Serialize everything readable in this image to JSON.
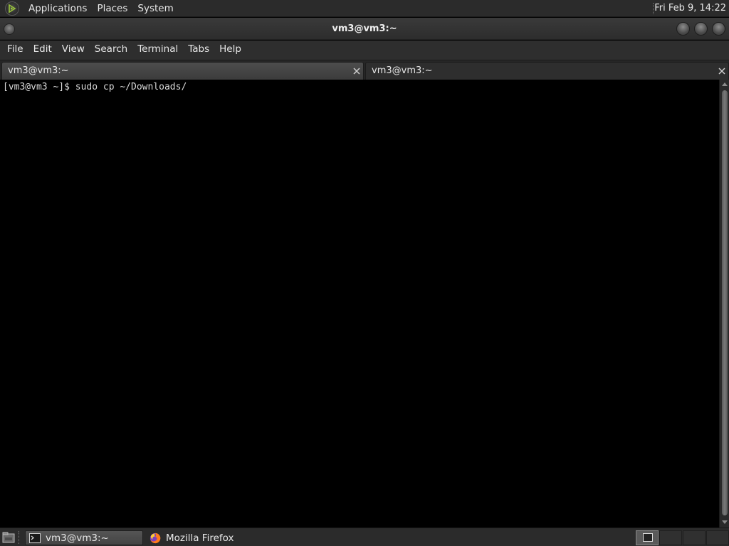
{
  "top_panel": {
    "menus": [
      "Applications",
      "Places",
      "System"
    ],
    "clock": "Fri Feb  9, 14:22"
  },
  "window": {
    "title": "vm3@vm3:~"
  },
  "menubar": {
    "items": [
      "File",
      "Edit",
      "View",
      "Search",
      "Terminal",
      "Tabs",
      "Help"
    ]
  },
  "tabs": [
    {
      "label": "vm3@vm3:~",
      "active": false
    },
    {
      "label": "vm3@vm3:~",
      "active": true
    }
  ],
  "terminal": {
    "lines": [
      "[vm3@vm3 ~]$ sudo cp ~/Downloads/"
    ]
  },
  "taskbar": {
    "tasks": [
      {
        "label": "vm3@vm3:~",
        "icon": "terminal-icon",
        "active": true
      },
      {
        "label": "Mozilla Firefox",
        "icon": "firefox-icon",
        "active": false
      }
    ]
  },
  "colors": {
    "panel_bg": "#2b2b2b",
    "terminal_bg": "#000000",
    "text": "#e8e8e8"
  }
}
